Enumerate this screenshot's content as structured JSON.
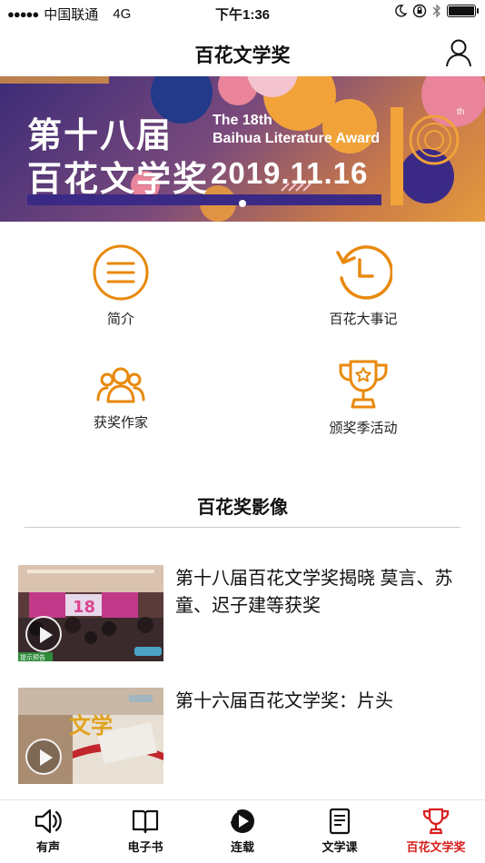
{
  "status_bar": {
    "signal": "●●●●●",
    "carrier": "中国联通",
    "network": "4G",
    "time": "下午1:36",
    "icons": [
      "moon-icon",
      "orientation-lock-icon",
      "bluetooth-icon",
      "battery-icon"
    ]
  },
  "nav": {
    "title": "百花文学奖",
    "right_icon": "person-icon"
  },
  "banner": {
    "title_line1": "第十八届",
    "title_line2": "百花文学奖",
    "en_line1": "The 18th",
    "en_line2": "Baihua Literature Award",
    "date": "2019.11.16",
    "th": "th",
    "page_indicator": {
      "current": 1,
      "total": 1
    }
  },
  "features": [
    {
      "label": "简介",
      "icon": "menu-lines-icon"
    },
    {
      "label": "百花大事记",
      "icon": "history-clock-icon"
    },
    {
      "label": "获奖作家",
      "icon": "group-people-icon"
    },
    {
      "label": "颁奖季活动",
      "icon": "trophy-star-icon"
    }
  ],
  "section": {
    "title": "百花奖影像"
  },
  "videos": [
    {
      "title": "第十八届百花文学奖揭晓 莫言、苏童、迟子建等获奖",
      "thumb_text": "提示预告"
    },
    {
      "title": "第十六届百花文学奖：片头",
      "thumb_text": "文学"
    }
  ],
  "tabs": [
    {
      "label": "有声",
      "icon": "speaker-icon",
      "active": false
    },
    {
      "label": "电子书",
      "icon": "open-book-icon",
      "active": false
    },
    {
      "label": "连载",
      "icon": "play-circle-icon",
      "active": false
    },
    {
      "label": "文学课",
      "icon": "book-icon",
      "active": false
    },
    {
      "label": "百花文学奖",
      "icon": "trophy-icon",
      "active": true
    }
  ],
  "colors": {
    "accent_orange": "#E8890C",
    "active_red": "#D81E1E",
    "banner_purple": "#3C2B78"
  }
}
